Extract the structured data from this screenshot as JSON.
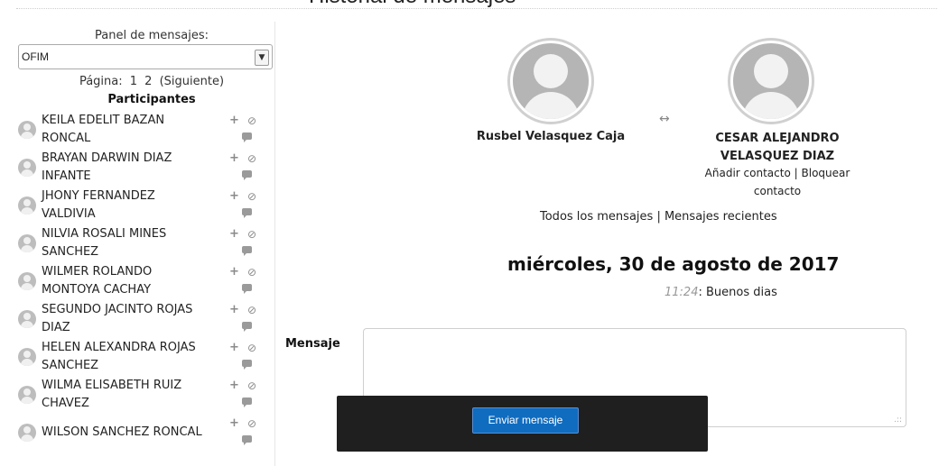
{
  "page": {
    "title": "Historial de mensajes"
  },
  "sidebar": {
    "panel_label": "Panel de mensajes:",
    "select_value": "OFIM",
    "paging": {
      "label": "Página:",
      "pages": [
        "1",
        "2"
      ],
      "next": "(Siguiente)"
    },
    "participants_title": "Participantes",
    "participants": [
      {
        "line1": "KEILA EDELIT BAZAN",
        "line2": "RONCAL"
      },
      {
        "line1": "BRAYAN DARWIN DIAZ",
        "line2": "INFANTE"
      },
      {
        "line1": "JHONY FERNANDEZ",
        "line2": "VALDIVIA"
      },
      {
        "line1": "NILVIA ROSALI MINES",
        "line2": "SANCHEZ"
      },
      {
        "line1": "WILMER ROLANDO",
        "line2": "MONTOYA CACHAY"
      },
      {
        "line1": "SEGUNDO JACINTO ROJAS",
        "line2": "DIAZ"
      },
      {
        "line1": "HELEN ALEXANDRA ROJAS",
        "line2": "SANCHEZ"
      },
      {
        "line1": "WILMA ELISABETH RUIZ",
        "line2": "CHAVEZ"
      },
      {
        "line1": "WILSON SANCHEZ RONCAL",
        "line2": ""
      }
    ],
    "icons": {
      "add": "plus-icon",
      "block": "block-icon",
      "message": "message-icon"
    }
  },
  "conversation": {
    "user_left": "Rusbel Velasquez Caja",
    "user_right_line1": "CESAR ALEJANDRO",
    "user_right_line2": "VELASQUEZ DIAZ",
    "add_contact": "Añadir contacto",
    "separator": "|",
    "block_contact_1": "Bloquear",
    "block_contact_2": "contacto",
    "all_messages": "Todos los mensajes",
    "recent_messages": "Mensajes recientes",
    "date": "miércoles, 30 de agosto de 2017",
    "message_time": "11:24",
    "message_text": ": Buenos dias"
  },
  "composer": {
    "label": "Mensaje",
    "send_label": "Enviar mensaje"
  },
  "colors": {
    "accent": "#0f6cbf",
    "dock": "#1f1f1f"
  }
}
